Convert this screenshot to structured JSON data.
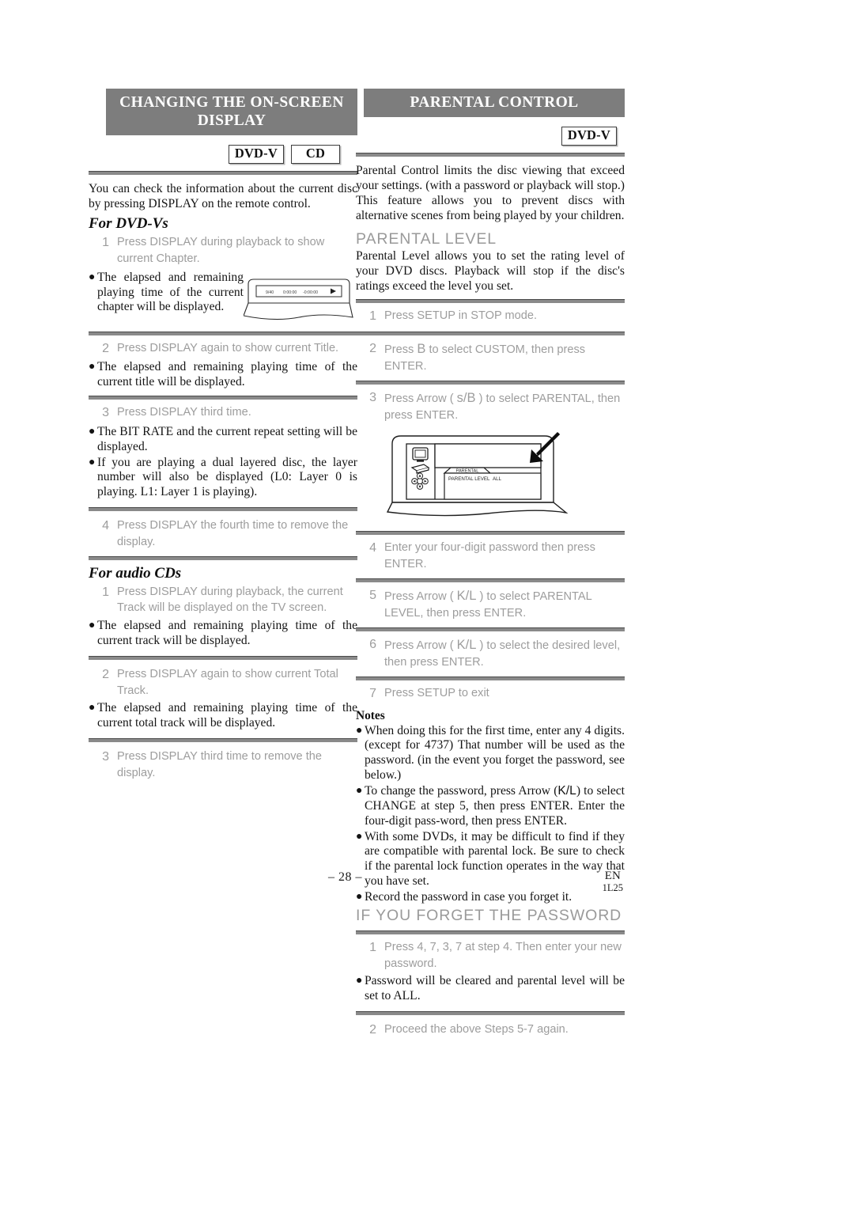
{
  "document": {
    "page_number": "– 28 –",
    "language_code": "EN",
    "doc_code": "1L25"
  },
  "left_column": {
    "banner_title": "CHANGING THE ON-SCREEN DISPLAY",
    "badges": [
      "DVD-V",
      "CD"
    ],
    "intro": "You can check the information about the current disc by pressing DISPLAY on the remote control.",
    "dvd_section": {
      "heading": "For DVD-Vs",
      "step1_num": "1",
      "step1_text": "Press DISPLAY during playback to show current Chapter.",
      "bullet1": "The elapsed and remaining playing time of the current chapter will be displayed.",
      "step2_num": "2",
      "step2_text": "Press DISPLAY again to show current Title.",
      "bullet2": "The elapsed and remaining playing time of the current title will be displayed.",
      "step3_num": "3",
      "step3_text": "Press DISPLAY third time.",
      "bullet3": "The BIT RATE and the current repeat setting will be displayed.",
      "bullet4": "If you are playing a dual layered disc, the layer number will also be displayed (L0: Layer 0 is playing. L1: Layer 1 is playing).",
      "step4_num": "4",
      "step4_text": "Press DISPLAY the fourth time to remove the display."
    },
    "cd_section": {
      "heading": "For audio CDs",
      "step1_num": "1",
      "step1_text": "Press DISPLAY during playback, the current Track will be displayed on the TV screen.",
      "bullet1": "The elapsed and remaining playing time of the current track will be displayed.",
      "step2_num": "2",
      "step2_text": "Press DISPLAY again to show current Total Track.",
      "bullet2": "The elapsed and remaining playing time of the current total track will be displayed.",
      "step3_num": "3",
      "step3_text": "Press DISPLAY third time to remove the display."
    },
    "tv_figure": {
      "chapter_counter": "9/40",
      "elapsed_time": "0:00:00",
      "remaining_time": "-0:00:00",
      "play_icon": "play-triangle"
    }
  },
  "right_column": {
    "banner_title": "PARENTAL CONTROL",
    "badges": [
      "DVD-V"
    ],
    "intro": "Parental Control limits the disc viewing that exceed your settings. (with a password or playback will stop.) This feature allows you to prevent discs with alternative scenes from being played by your children.",
    "parental_level": {
      "heading": "PARENTAL LEVEL",
      "intro": "Parental Level allows you to set the rating level of your DVD discs. Playback will stop if the disc's ratings exceed the level you set.",
      "step1_num": "1",
      "step1_text": "Press SETUP in STOP mode.",
      "step2_num": "2",
      "step2_text_a": "Press",
      "step2_glyph": "B",
      "step2_text_b": "to select CUSTOM, then press ENTER.",
      "step3_num": "3",
      "step3_text_a": "Press Arrow (",
      "step3_glyph_a": "s",
      "step3_slash": "/",
      "step3_glyph_b": "B",
      "step3_text_b": ") to select PARENTAL, then press ENTER.",
      "step4_num": "4",
      "step4_text": "Enter your four-digit password then press ENTER.",
      "step5_num": "5",
      "step5_text_a": "Press Arrow (",
      "step5_glyph": "K/L",
      "step5_text_b": ") to select PARENTAL LEVEL, then press ENTER.",
      "step6_num": "6",
      "step6_text_a": "Press Arrow (",
      "step6_glyph": "K/L",
      "step6_text_b": ") to select the desired level, then press ENTER.",
      "step7_num": "7",
      "step7_text": "Press SETUP to exit"
    },
    "menu_figure": {
      "tab_label": "PARENTAL",
      "row_label": "PARENTAL LEVEL",
      "row_value": "ALL",
      "arrow": "pointer-arrow"
    },
    "notes": {
      "heading": "Notes",
      "note1": "When doing this for the first time, enter any 4 digits. (except for 4737) That number will be used as the password. (in the event you forget the password, see below.)",
      "note2_a": "To change the password, press Arrow (",
      "note2_glyph": "K/L",
      "note2_b": ") to select CHANGE at step 5, then press ENTER. Enter the four-digit pass-word, then press ENTER.",
      "note3": "With some DVDs, it may be difficult to find if they are compatible with parental lock. Be sure to check if the parental lock function operates in the way that you have set.",
      "note4": "Record the password in case you forget it."
    },
    "forgot_password": {
      "heading": "IF YOU FORGET THE PASSWORD",
      "step1_num": "1",
      "step1_text": "Press 4, 7, 3, 7 at step 4. Then enter your new password.",
      "bullet1": "Password will be cleared and parental level will be set to ALL.",
      "step2_num": "2",
      "step2_text": "Proceed the above Steps 5-7 again."
    }
  }
}
